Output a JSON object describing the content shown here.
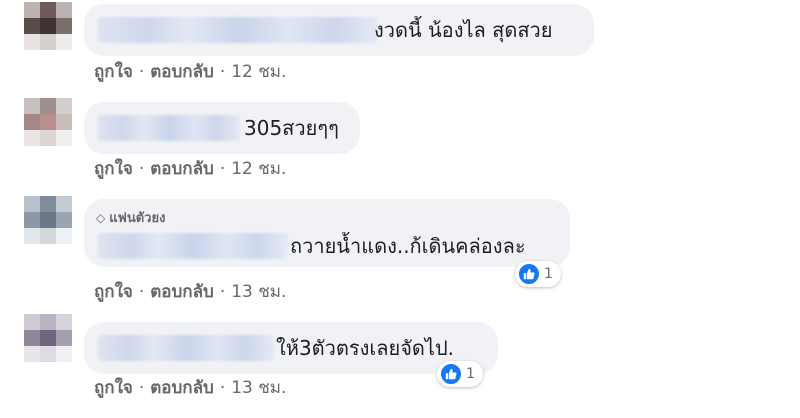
{
  "comments": [
    {
      "text": "งวดนี้ น้องไล สุดสวย",
      "actions": {
        "like": "ถูกใจ",
        "reply": "ตอบกลับ",
        "time": "12 ชม."
      }
    },
    {
      "text": "305สวยๆๆ",
      "actions": {
        "like": "ถูกใจ",
        "reply": "ตอบกลับ",
        "time": "12 ชม."
      }
    },
    {
      "badge": "แฟนตัวยง",
      "text": "ถวายน้ำแดง..ก้เดินคล่องละ",
      "actions": {
        "like": "ถูกใจ",
        "reply": "ตอบกลับ",
        "time": "13 ชม."
      },
      "reactions": {
        "icon": "like-icon",
        "count": "1"
      }
    },
    {
      "text": "ให้3ตัวตรงเลยจัดไป.",
      "actions": {
        "like": "ถูกใจ",
        "reply": "ตอบกลับ",
        "time": "13 ชม."
      },
      "reactions": {
        "icon": "like-icon",
        "count": "1"
      }
    }
  ],
  "separator": "·",
  "colors": {
    "bubble": "#f0f2f5",
    "meta": "#65676b",
    "text": "#1c1e21",
    "like": "#1877f2"
  }
}
